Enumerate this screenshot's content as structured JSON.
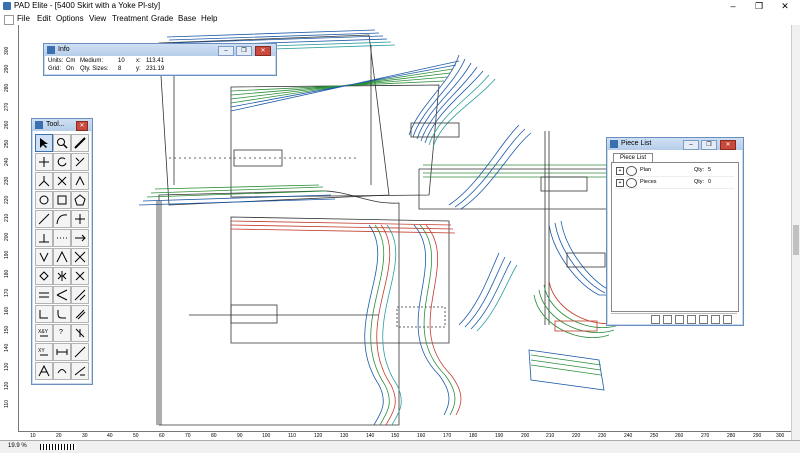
{
  "app": {
    "title": "PAD Elite - [5400 Skirt with a Yoke Pl-sty]"
  },
  "menu": [
    "File",
    "Edit",
    "Options",
    "View",
    "Treatment",
    "Grade",
    "Base",
    "Help"
  ],
  "info": {
    "title": "Info",
    "row1": [
      "Units:",
      "Cm",
      "Medium:",
      "10",
      "x:",
      "113.41"
    ],
    "row2": [
      "Grid:",
      "On",
      "Qty. Sizes:",
      "8",
      "y:",
      "231.19"
    ]
  },
  "toolbox": {
    "title": "Tool..."
  },
  "piece_list": {
    "title": "Piece List",
    "tab": "Piece List",
    "rows": [
      {
        "name": "Plan",
        "qty_label": "Qty:",
        "qty": "5"
      },
      {
        "name": "Pieces",
        "qty_label": "Qty:",
        "qty": "0"
      }
    ]
  },
  "left_ruler": [
    "300",
    "290",
    "280",
    "270",
    "260",
    "250",
    "240",
    "230",
    "220",
    "210",
    "200",
    "190",
    "180",
    "170",
    "160",
    "150",
    "140",
    "130",
    "120",
    "110"
  ],
  "bottom_ruler": [
    "10",
    "20",
    "30",
    "40",
    "50",
    "60",
    "70",
    "80",
    "90",
    "100",
    "110",
    "120",
    "130",
    "140",
    "150",
    "160",
    "170",
    "180",
    "190",
    "200",
    "210",
    "220",
    "230",
    "240",
    "250",
    "260",
    "270",
    "280",
    "290",
    "300"
  ],
  "status": {
    "zoom": "19.9 %"
  },
  "colors": {
    "titlebar_gradient_top": "#cfe0f4",
    "close_red": "#c94a3c",
    "lines": [
      "#1c5aa8",
      "#2c8f3a",
      "#c23b2b",
      "#2a9d9d",
      "#6b3fa0",
      "#e08b2a"
    ]
  }
}
